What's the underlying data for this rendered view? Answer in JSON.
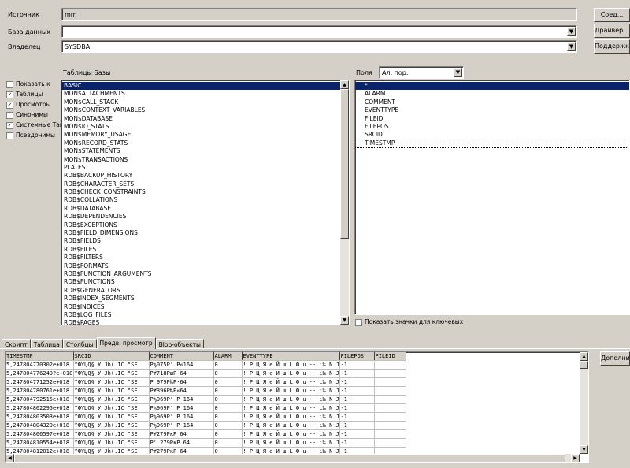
{
  "connection": {
    "source_label": "Источник",
    "source_value": "mm",
    "database_label": "База данных",
    "database_value": "",
    "owner_label": "Владелец",
    "owner_value": "SYSDBA"
  },
  "buttons": {
    "connect": "Соед...",
    "driver": "Драйвер...",
    "support": "Поддержка...",
    "extra": "Дополните..."
  },
  "options": [
    {
      "label": "Показать к",
      "checked": false
    },
    {
      "label": "Таблицы",
      "checked": true
    },
    {
      "label": "Просмотры",
      "checked": true
    },
    {
      "label": "Синонимы",
      "checked": false
    },
    {
      "label": "Системные Таг",
      "checked": true
    },
    {
      "label": "Псевдонимы",
      "checked": false
    }
  ],
  "tables_label": "Таблицы Базы",
  "tables": [
    "BASIC",
    "MON$ATTACHMENTS",
    "MON$CALL_STACK",
    "MON$CONTEXT_VARIABLES",
    "MON$DATABASE",
    "MON$IO_STATS",
    "MON$MEMORY_USAGE",
    "MON$RECORD_STATS",
    "MON$STATEMENTS",
    "MON$TRANSACTIONS",
    "PLATES",
    "RDB$BACKUP_HISTORY",
    "RDB$CHARACTER_SETS",
    "RDB$CHECK_CONSTRAINTS",
    "RDB$COLLATIONS",
    "RDB$DATABASE",
    "RDB$DEPENDENCIES",
    "RDB$EXCEPTIONS",
    "RDB$FIELD_DIMENSIONS",
    "RDB$FIELDS",
    "RDB$FILES",
    "RDB$FILTERS",
    "RDB$FORMATS",
    "RDB$FUNCTION_ARGUMENTS",
    "RDB$FUNCTIONS",
    "RDB$GENERATORS",
    "RDB$INDEX_SEGMENTS",
    "RDB$INDICES",
    "RDB$LOG_FILES",
    "RDB$PAGES"
  ],
  "fields_label": "Поля",
  "fields_sort": "Ал. пор.",
  "fields": [
    "*",
    "ALARM",
    "COMMENT",
    "EVENTTYPE",
    "FILEID",
    "FILEPOS",
    "SRCID",
    "TIMESTMP"
  ],
  "show_key_icons": "Показать значки для ключевых",
  "tabs": [
    "Скрипт",
    "Таблица",
    "Столбцы",
    "Предв. просмотр",
    "Blob-объекты"
  ],
  "active_tab": 3,
  "grid": {
    "columns": [
      "TIMESTMP",
      "SRCID",
      "COMMENT",
      "ALARM",
      "EVENTTYPE",
      "FILEPOS",
      "FILEID"
    ],
    "rows": [
      [
        "5,247804770302e+018",
        "^ФYЏQ§ У Jh(.IC \"SE",
        "Pђ075P' P«164",
        "0",
        "! P Ц Я е Й ш L Ф u ·· i‰ N J",
        "-1",
        ""
      ],
      [
        "5,247804776249?e+018",
        "^ФYЏQ§ У Jh(.IC \"SE",
        "P¥718PшP 64",
        "0",
        "! P Ц Я е Й ш L Ф u ·· i‰ N J",
        "-1",
        ""
      ],
      [
        "5,247804771252e+018",
        "^ФYЏQ§ У Jh(.IC \"SE",
        "P 979PђP·64",
        "0",
        "! P Ц Я е Й ш L Ф u ·· i‰ N J",
        "-1",
        ""
      ],
      [
        "5,247804780761e+018",
        "^ФYЏQ§ У Jh(.IC \"SE",
        "P¥396PђP«64",
        "0",
        "! P Ц Я е Й ш L Ф u ·· i‰ N J",
        "-1",
        ""
      ],
      [
        "5,247804792515e+018",
        "^ФYЏQ§ У Jh(.IC \"SE",
        "Pђ969P' P 164",
        "0",
        "! P Ц Я е Й ш L Ф u ·· i‰ N J",
        "-1",
        ""
      ],
      [
        "5,247804802295e+018",
        "^ФYЏQ§ У Jh(.IC \"SE",
        "Pђ969P' P 164",
        "0",
        "! P Ц Я е Й ш L Ф u ·· i‰ N J",
        "-1",
        ""
      ],
      [
        "5,247804803503e+018",
        "^ФYЏQ§ У Jh(.IC \"SE",
        "Pђ969P' P 164",
        "0",
        "! P Ц Я е Й ш L Ф u ·· i‰ N J",
        "-1",
        ""
      ],
      [
        "5,247804804329e+018",
        "^ФYЏQ§ У Jh(.IC \"SE",
        "Pђ969P' P 164",
        "0",
        "! P Ц Я е Й ш L Ф u ·· i‰ N J",
        "-1",
        ""
      ],
      [
        "5,247804806597e+018",
        "^ФYЏQ§ У Jh(.IC \"SE",
        "P¥279PкP 64",
        "0",
        "! P Ц Я е Й ш L Ф u ·· i‰ N J",
        "-1",
        ""
      ],
      [
        "5,247804810554e+018",
        "^ФYЏQ§ У Jh(.IC \"SE",
        "P' 279PкP 64",
        "0",
        "! P Ц Я е Й ш L Ф u ·· i‰ N J",
        "-1",
        ""
      ],
      [
        "5,247804812012e+018",
        "^ФYЏQ§ У Jh(.IC \"SE",
        "P¥279PкP 64",
        "0",
        "! P Ц Я е Й ш L Ф u ·· i‰ N J",
        "-1",
        ""
      ]
    ]
  }
}
